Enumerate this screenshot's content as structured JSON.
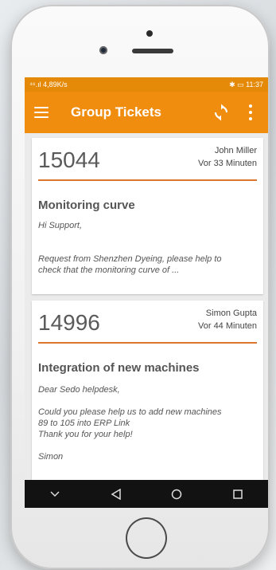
{
  "statusbar": {
    "left": "⁴⁶.ıl 4,89K/s",
    "right": "✱ ▭ 11:37"
  },
  "appbar": {
    "title": "Group Tickets",
    "icons": [
      "menu-icon",
      "sync-icon",
      "more-vert-icon"
    ]
  },
  "tickets": [
    {
      "number": "15044",
      "author": "John Miller",
      "time": "Vor 33 Minuten",
      "subject": "Monitoring curve",
      "body": [
        "Hi Support,",
        "",
        "Request from Shenzhen Dyeing, please help to",
        "check that the monitoring curve of ..."
      ]
    },
    {
      "number": "14996",
      "author": "Simon Gupta",
      "time": "Vor 44 Minuten",
      "subject": "Integration of new machines",
      "body": [
        "Dear Sedo helpdesk,",
        "",
        "Could you please help us to add new machines",
        "89 to 105 into ERP Link",
        "Thank you for your help!",
        "",
        "Simon"
      ]
    }
  ],
  "navbar": {
    "icons": [
      "collapse-icon",
      "back-icon",
      "home-icon",
      "recents-icon"
    ]
  },
  "colors": {
    "accent": "#f08c0e",
    "rule": "#d8772d",
    "statusbar": "#e58a08"
  }
}
